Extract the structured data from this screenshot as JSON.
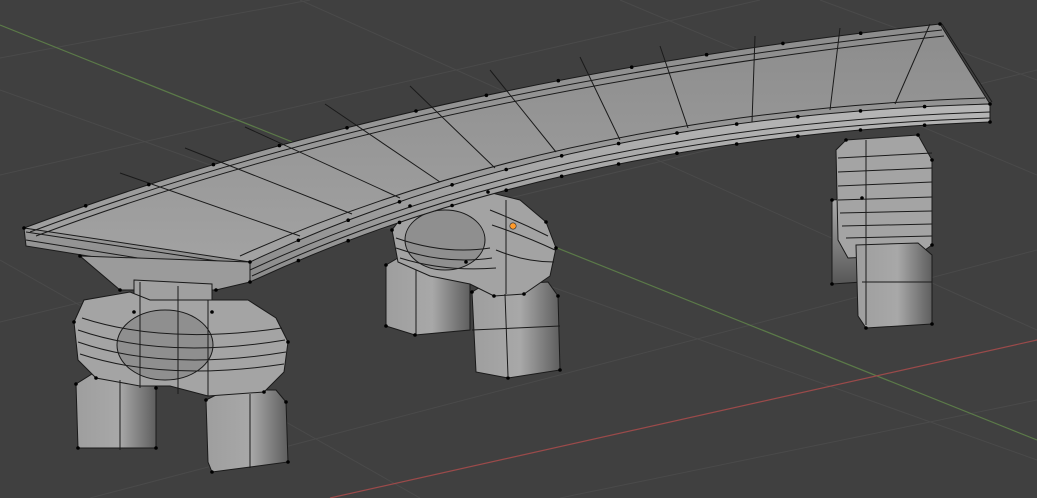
{
  "viewport": {
    "mode": "edit-mode",
    "view": "perspective",
    "background_color": "#404040",
    "grid_color": "#4a4a4a",
    "x_axis_color": "#9b4a4a",
    "y_axis_color": "#5b7a48",
    "mesh_face_color": "#9a9a9a",
    "mesh_edge_color": "#1a1a1a",
    "vertex_color": "#000000",
    "origin_color": "#ff9a2a",
    "object": "curved-stone-bench-mesh",
    "object_parts": [
      "bench-seat",
      "left-leg",
      "middle-leg",
      "right-leg"
    ]
  }
}
